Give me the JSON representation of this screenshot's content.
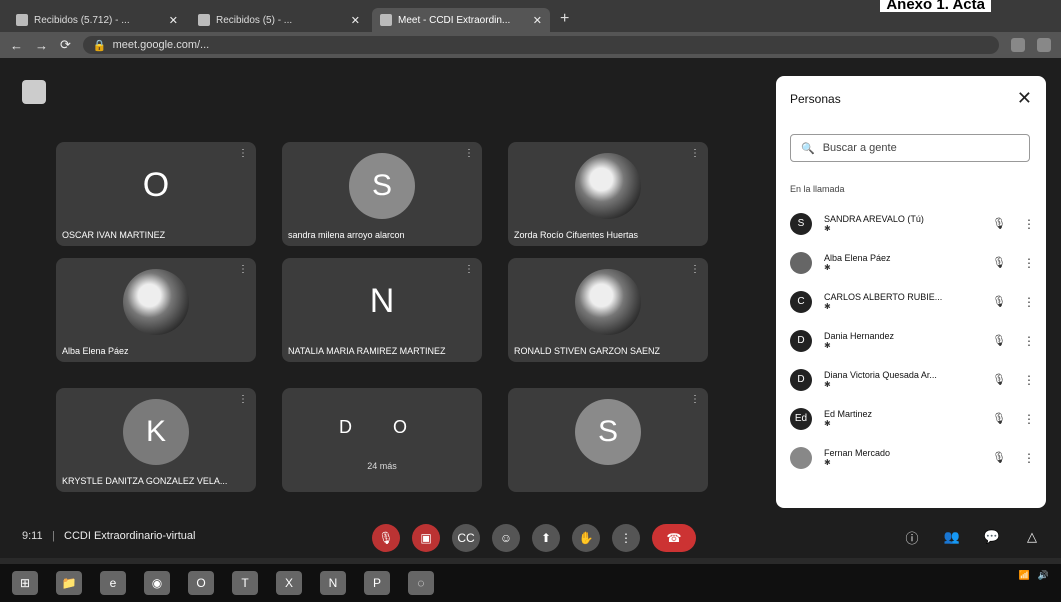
{
  "document_header": "Anexo 1. Acta",
  "browser": {
    "tabs": [
      {
        "title": "Recibidos (5.712) - ...",
        "active": false
      },
      {
        "title": "Recibidos (5) - ...",
        "active": false
      },
      {
        "title": "Meet - CCDI Extraordin...",
        "active": true
      }
    ],
    "new_tab": "+",
    "url": "meet.google.com/..."
  },
  "meet": {
    "tiles": [
      {
        "initial": "O",
        "name": "OSCAR IVAN MARTINEZ",
        "kind": "plain",
        "color": ""
      },
      {
        "initial": "S",
        "name": "sandra milena arroyo alarcon",
        "kind": "circle",
        "color": "#8a8a8a"
      },
      {
        "initial": "",
        "name": "Zorda Rocío Cifuentes Huertas",
        "kind": "photo",
        "color": ""
      },
      {
        "initial": "",
        "name": "Alba Elena Páez",
        "kind": "photo",
        "color": ""
      },
      {
        "initial": "N",
        "name": "NATALIA MARIA RAMIREZ MARTINEZ",
        "kind": "plain",
        "color": ""
      },
      {
        "initial": "",
        "name": "RONALD STIVEN GARZON SAENZ",
        "kind": "photo",
        "color": ""
      },
      {
        "initial": "K",
        "name": "KRYSTLE DANITZA GONZALEZ VELA...",
        "kind": "circle",
        "color": "#7a7a7a"
      },
      {
        "initial": "D  O",
        "name": "",
        "kind": "more",
        "color": "",
        "more": "24 más"
      },
      {
        "initial": "S",
        "name": "",
        "kind": "circle",
        "color": "#8a8a8a"
      }
    ],
    "time": "9:11",
    "separator": "|",
    "meeting_name": "CCDI Extraordinario-virtual"
  },
  "people_panel": {
    "title": "Personas",
    "close": "✕",
    "search_placeholder": "Buscar a gente",
    "section_label": "En la llamada",
    "people": [
      {
        "initial": "S",
        "name": "SANDRA AREVALO (Tú)",
        "sub": "✱"
      },
      {
        "initial": "",
        "name": "Alba Elena Páez",
        "sub": "✱"
      },
      {
        "initial": "C",
        "name": "CARLOS ALBERTO RUBIE...",
        "sub": "✱"
      },
      {
        "initial": "D",
        "name": "Dania Hernandez",
        "sub": "✱"
      },
      {
        "initial": "D",
        "name": "Diana Victoria Quesada Ar...",
        "sub": "✱"
      },
      {
        "initial": "Ed",
        "name": "Ed Martinez",
        "sub": "✱"
      },
      {
        "initial": "",
        "name": "Fernan Mercado",
        "sub": "✱"
      }
    ]
  }
}
